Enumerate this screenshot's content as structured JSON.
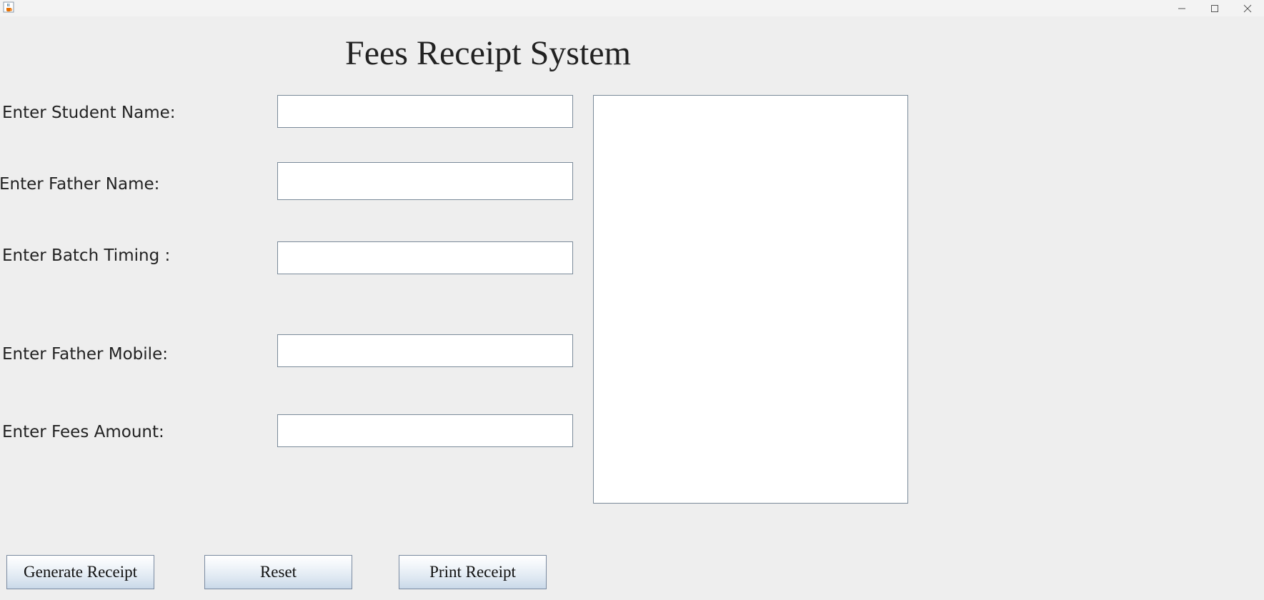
{
  "window": {
    "icon": "java-coffee-cup-icon",
    "controls": {
      "minimize": "minimize-icon",
      "maximize": "maximize-icon",
      "close": "close-icon"
    }
  },
  "title": "Fees Receipt System",
  "fields": {
    "student_name": {
      "label": "Enter Student Name:",
      "value": ""
    },
    "father_name": {
      "label": "Enter Father Name:",
      "value": ""
    },
    "batch_timing": {
      "label": "Enter Batch Timing :",
      "value": ""
    },
    "father_mobile": {
      "label": "Enter Father Mobile:",
      "value": ""
    },
    "fees_amount": {
      "label": "Enter Fees Amount:",
      "value": ""
    }
  },
  "receipt": {
    "text": ""
  },
  "buttons": {
    "generate": "Generate Receipt",
    "reset": "Reset",
    "print": "Print Receipt"
  },
  "colors": {
    "background": "#eeeeee",
    "field_border": "#7a8a99",
    "button_gradient_bottom": "#c9d8e8"
  }
}
